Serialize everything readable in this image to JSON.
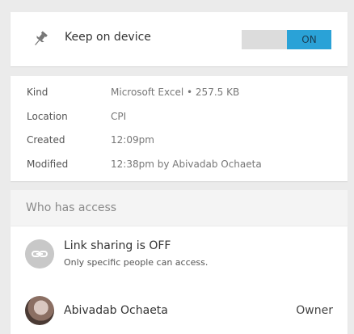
{
  "keep_on_device": {
    "label": "Keep on device",
    "toggle_state": "ON",
    "icon": "pin-icon"
  },
  "details": [
    {
      "key": "Kind",
      "value": "Microsoft Excel • 257.5 KB"
    },
    {
      "key": "Location",
      "value": "CPI"
    },
    {
      "key": "Created",
      "value": "12:09pm"
    },
    {
      "key": "Modified",
      "value": "12:38pm by Abivadab Ochaeta"
    }
  ],
  "access": {
    "header": "Who has access",
    "link_sharing": {
      "title": "Link sharing is OFF",
      "subtitle": "Only specific people can access.",
      "icon": "link-icon"
    },
    "owner": {
      "name": "Abivadab Ochaeta",
      "role": "Owner"
    }
  },
  "colors": {
    "toggle_on": "#2aa2d7",
    "background": "#ebebeb"
  }
}
